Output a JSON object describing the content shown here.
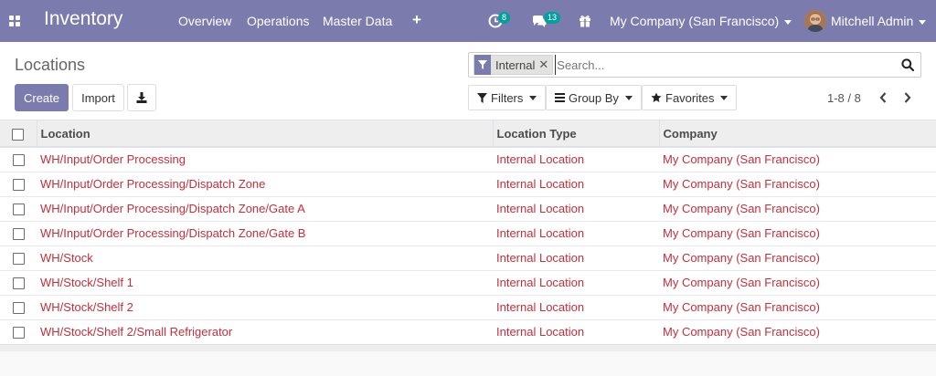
{
  "navbar": {
    "app_name": "Inventory",
    "menu": [
      {
        "label": "Overview"
      },
      {
        "label": "Operations"
      },
      {
        "label": "Master Data"
      }
    ],
    "activity_count": "8",
    "message_count": "13",
    "company": "My Company (San Francisco)",
    "user": "Mitchell Admin"
  },
  "control_panel": {
    "breadcrumb": "Locations",
    "search": {
      "facet_label": "Internal",
      "placeholder": "Search..."
    },
    "buttons": {
      "create": "Create",
      "import": "Import"
    },
    "filters": {
      "filters_label": "Filters",
      "group_by_label": "Group By",
      "favorites_label": "Favorites"
    },
    "pager": "1-8 / 8"
  },
  "list": {
    "columns": [
      "Location",
      "Location Type",
      "Company"
    ],
    "rows": [
      {
        "location": "WH/Input/Order Processing",
        "type": "Internal Location",
        "company": "My Company (San Francisco)"
      },
      {
        "location": "WH/Input/Order Processing/Dispatch Zone",
        "type": "Internal Location",
        "company": "My Company (San Francisco)"
      },
      {
        "location": "WH/Input/Order Processing/Dispatch Zone/Gate A",
        "type": "Internal Location",
        "company": "My Company (San Francisco)"
      },
      {
        "location": "WH/Input/Order Processing/Dispatch Zone/Gate B",
        "type": "Internal Location",
        "company": "My Company (San Francisco)"
      },
      {
        "location": "WH/Stock",
        "type": "Internal Location",
        "company": "My Company (San Francisco)"
      },
      {
        "location": "WH/Stock/Shelf 1",
        "type": "Internal Location",
        "company": "My Company (San Francisco)"
      },
      {
        "location": "WH/Stock/Shelf 2",
        "type": "Internal Location",
        "company": "My Company (San Francisco)"
      },
      {
        "location": "WH/Stock/Shelf 2/Small Refrigerator",
        "type": "Internal Location",
        "company": "My Company (San Francisco)"
      }
    ]
  },
  "colors": {
    "brand": "#7c7bad",
    "link": "#c32f3c",
    "badge": "#00a09d"
  },
  "icons": [
    "apps-grid-icon",
    "plus-icon",
    "activity-clock-icon",
    "chat-icon",
    "gift-icon",
    "filter-funnel-icon",
    "close-icon",
    "search-icon",
    "download-icon",
    "bars-icon",
    "star-icon",
    "chevron-left-icon",
    "chevron-right-icon"
  ]
}
